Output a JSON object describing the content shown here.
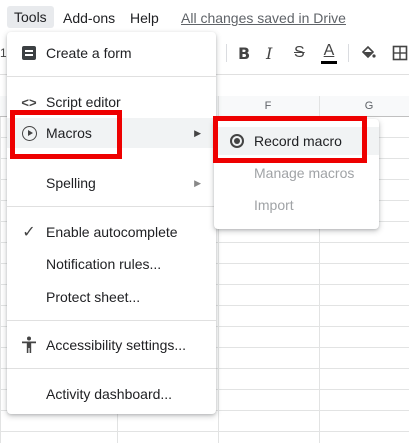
{
  "menubar": {
    "tools": "Tools",
    "addons": "Add-ons",
    "help": "Help",
    "saved_status": "All changes saved in Drive"
  },
  "toolbar": {
    "left_clip": "1",
    "bold": "B",
    "italic": "I",
    "strike": "S",
    "text_color": "A",
    "fill_icon": "paint-bucket-icon",
    "borders_icon": "borders-icon"
  },
  "sheet": {
    "columns": [
      "F",
      "G"
    ]
  },
  "tools_menu": {
    "items": [
      {
        "label": "Create a form",
        "icon": "form-icon"
      },
      {
        "label": "Script editor",
        "icon": "code-icon"
      },
      {
        "label": "Macros",
        "icon": "play-circle-icon"
      },
      {
        "label": "Spelling"
      },
      {
        "label": "Enable autocomplete",
        "icon": "check-icon"
      },
      {
        "label": "Notification rules..."
      },
      {
        "label": "Protect sheet..."
      },
      {
        "label": "Accessibility settings...",
        "icon": "accessibility-icon"
      },
      {
        "label": "Activity dashboard..."
      }
    ]
  },
  "macros_submenu": {
    "items": [
      {
        "label": "Record macro",
        "icon": "radio-record-icon"
      },
      {
        "label": "Manage macros"
      },
      {
        "label": "Import"
      }
    ]
  },
  "colors": {
    "highlight_box": "#ee0000",
    "hover": "#f1f3f4",
    "disabled_text": "#a0a3a6"
  }
}
